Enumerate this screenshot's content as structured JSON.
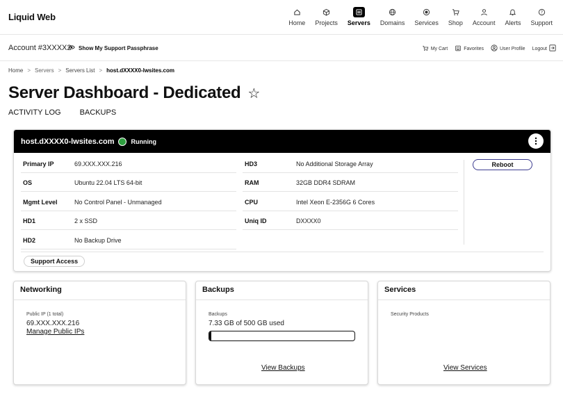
{
  "brand": "Liquid Web",
  "nav": [
    {
      "label": "Home",
      "icon": "home-icon",
      "active": false
    },
    {
      "label": "Projects",
      "icon": "cube-icon",
      "active": false
    },
    {
      "label": "Servers",
      "icon": "servers-icon",
      "active": true
    },
    {
      "label": "Domains",
      "icon": "globe-icon",
      "active": false
    },
    {
      "label": "Services",
      "icon": "services-icon",
      "active": false
    },
    {
      "label": "Shop",
      "icon": "cart-icon",
      "active": false
    },
    {
      "label": "Account",
      "icon": "user-icon",
      "active": false
    },
    {
      "label": "Alerts",
      "icon": "bell-icon",
      "active": false
    },
    {
      "label": "Support",
      "icon": "help-icon",
      "active": false
    }
  ],
  "account": {
    "label": "Account #3XXXX2",
    "passphrase": "Show My Support Passphrase"
  },
  "utils": {
    "cart": "My Cart",
    "favorites": "Favorites",
    "profile": "User Profile",
    "logout": "Logout"
  },
  "breadcrumb": [
    "Home",
    "Servers",
    "Servers List",
    "host.dXXXX0-lwsites.com"
  ],
  "page_title": "Server Dashboard - Dedicated",
  "tabs": [
    "ACTIVITY LOG",
    "BACKUPS"
  ],
  "server": {
    "host": "host.dXXXX0-lwsites.com",
    "status": "Running",
    "status_color": "#2e9e3f",
    "reboot": "Reboot",
    "support_access": "Support Access",
    "specs_left": [
      {
        "k": "Primary IP",
        "v": "69.XXX.XXX.216"
      },
      {
        "k": "OS",
        "v": "Ubuntu 22.04 LTS 64-bit"
      },
      {
        "k": "Mgmt Level",
        "v": "No Control Panel - Unmanaged"
      },
      {
        "k": "HD1",
        "v": "2 x SSD"
      },
      {
        "k": "HD2",
        "v": "No Backup Drive"
      }
    ],
    "specs_right": [
      {
        "k": "HD3",
        "v": "No Additional Storage Array"
      },
      {
        "k": "RAM",
        "v": "32GB DDR4 SDRAM"
      },
      {
        "k": "CPU",
        "v": "Intel Xeon E-2356G 6 Cores"
      },
      {
        "k": "Uniq ID",
        "v": "DXXXX0"
      }
    ]
  },
  "networking": {
    "title": "Networking",
    "sub": "Public IP (1 total)",
    "ip": "69.XXX.XXX.216",
    "link": "Manage Public IPs"
  },
  "backups": {
    "title": "Backups",
    "sub": "Backups",
    "usage": "7.33 GB of 500 GB used",
    "used_fraction": 0.0147,
    "link": "View Backups"
  },
  "services": {
    "title": "Services",
    "sub": "Security Products",
    "link": "View Services"
  }
}
